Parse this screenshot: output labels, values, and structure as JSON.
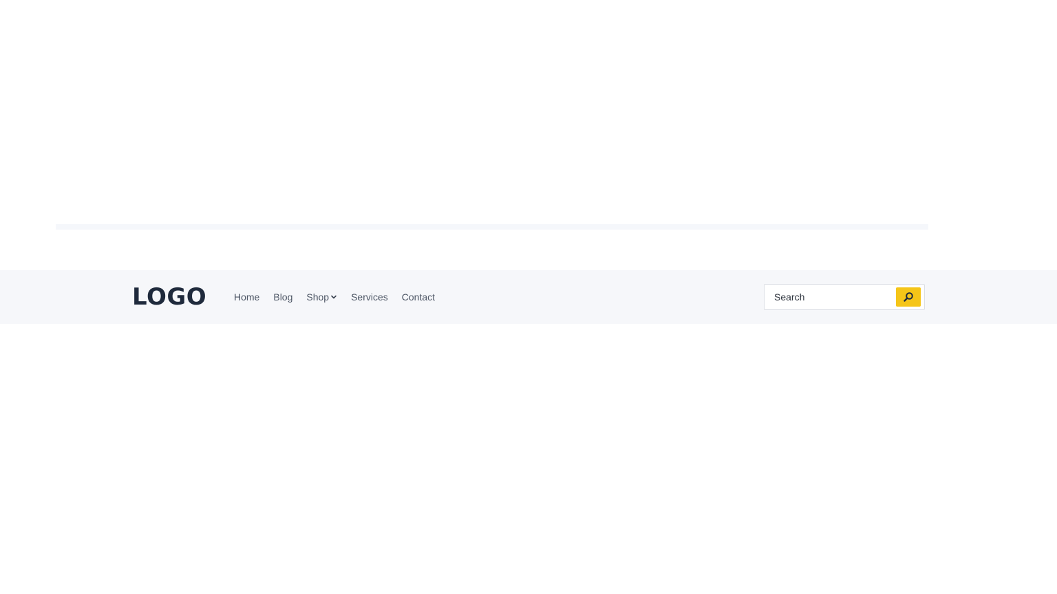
{
  "header": {
    "logo_text": "LOGO",
    "nav_items": [
      {
        "label": "Home"
      },
      {
        "label": "Blog"
      },
      {
        "label": "Shop",
        "has_dropdown": true
      },
      {
        "label": "Services"
      },
      {
        "label": "Contact"
      }
    ],
    "search": {
      "placeholder": "Search",
      "button_icon": "search-icon"
    }
  },
  "colors": {
    "header_bg": "#f6f7fa",
    "logo": "#1f2a3c",
    "nav_text": "#4b5463",
    "accent": "#f5c518"
  }
}
